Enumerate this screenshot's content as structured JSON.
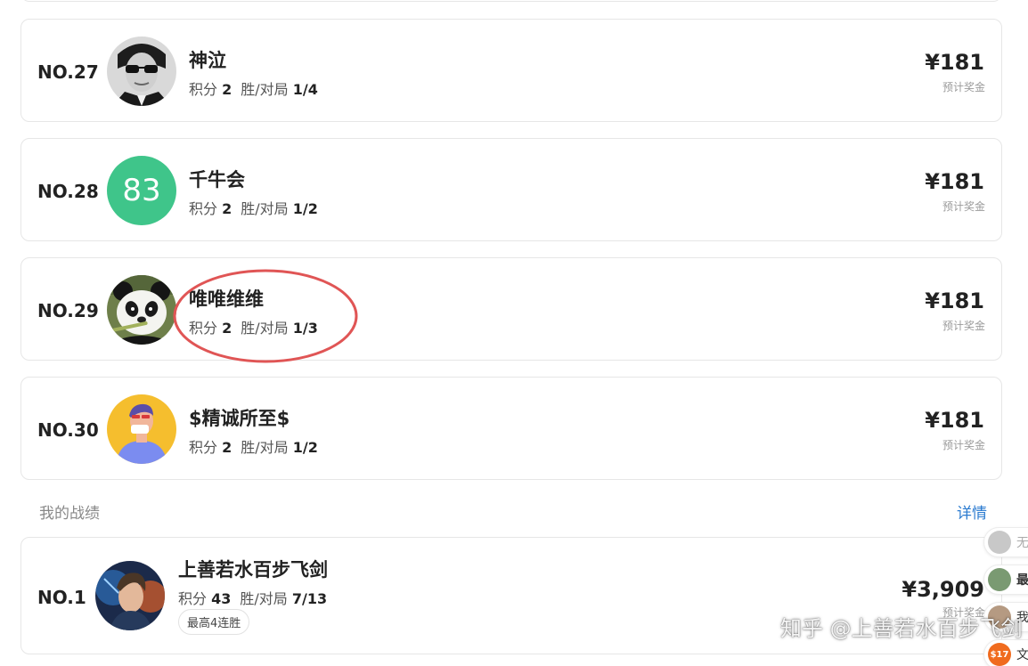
{
  "leaderboard": [
    {
      "rank": "NO.27",
      "name": "神泣",
      "score_label": "积分",
      "score": "2",
      "record_label": "胜/对局",
      "record": "1/4",
      "prize": "¥181",
      "prize_label": "预计奖金",
      "avatar": "person-sunglasses"
    },
    {
      "rank": "NO.28",
      "name": "千牛会",
      "score_label": "积分",
      "score": "2",
      "record_label": "胜/对局",
      "record": "1/2",
      "prize": "¥181",
      "prize_label": "预计奖金",
      "avatar": "number-83",
      "avatar_text": "83",
      "avatar_color": "#3fc58a"
    },
    {
      "rank": "NO.29",
      "name": "唯唯维维",
      "score_label": "积分",
      "score": "2",
      "record_label": "胜/对局",
      "record": "1/3",
      "prize": "¥181",
      "prize_label": "预计奖金",
      "avatar": "panda"
    },
    {
      "rank": "NO.30",
      "name": "$精诚所至$",
      "score_label": "积分",
      "score": "2",
      "record_label": "胜/对局",
      "record": "1/2",
      "prize": "¥181",
      "prize_label": "预计奖金",
      "avatar": "cartoon-man-masked",
      "avatar_color": "#f5be2e"
    }
  ],
  "my_record": {
    "section_title": "我的战绩",
    "details_link": "详情",
    "rank": "NO.1",
    "name": "上善若水百步飞剑",
    "score_label": "积分",
    "score": "43",
    "record_label": "胜/对局",
    "record": "7/13",
    "badge": "最高4连胜",
    "prize": "¥3,909",
    "prize_label": "预计奖金",
    "avatar": "game-hero"
  },
  "side_panel": [
    {
      "text": "无",
      "avatar": "gray-avatar"
    },
    {
      "text": "最",
      "avatar": "green-avatar"
    },
    {
      "text": "我",
      "avatar": "face-avatar"
    },
    {
      "text": "文",
      "avatar": "orange-badge",
      "avatar_text": "$17"
    }
  ],
  "watermark": "知乎 @上善若水百步飞剑",
  "watermark_logo": "知",
  "colors": {
    "link": "#2b7bd0",
    "highlight": "#e05555",
    "avatar_83": "#3fc58a",
    "avatar_30": "#f5be2e"
  }
}
